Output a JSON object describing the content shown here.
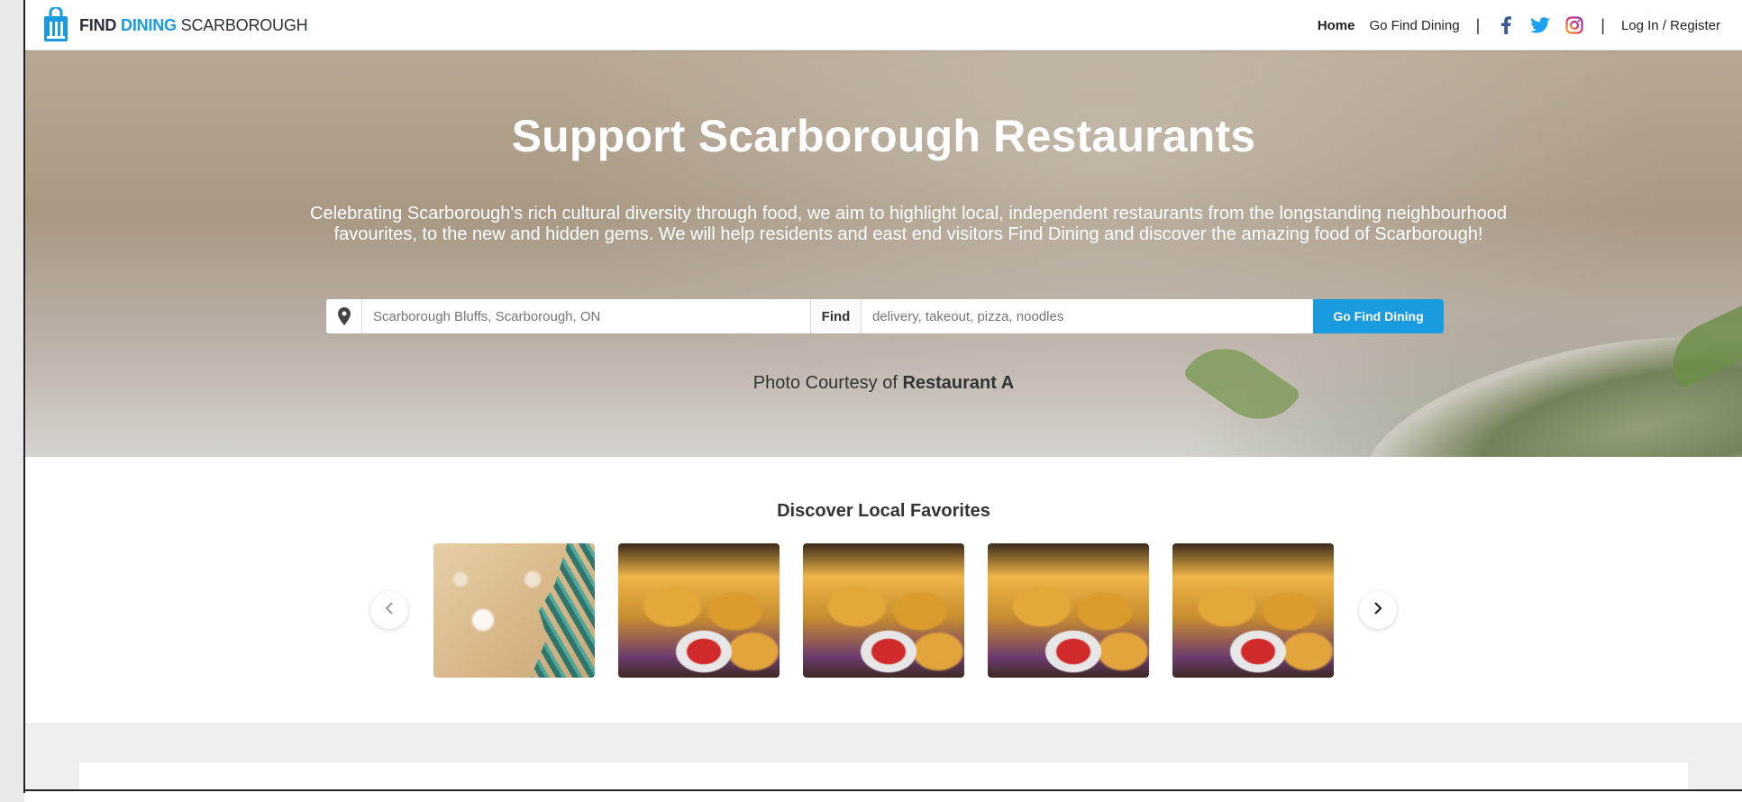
{
  "header": {
    "logo": {
      "part1": "FIND",
      "part2": "DINING",
      "part3": "SCARBOROUGH"
    },
    "nav": {
      "home": "Home",
      "go_find": "Go Find Dining",
      "separator": "|",
      "login": "Log In / Register"
    },
    "social_icons": [
      "facebook-icon",
      "twitter-icon",
      "instagram-icon"
    ]
  },
  "hero": {
    "title": "Support Scarborough Restaurants",
    "description": "Celebrating Scarborough's rich cultural diversity through food, we aim to highlight local, independent restaurants from the longstanding neighbourhood favourites, to the new and hidden gems. We will help residents and east end visitors Find Dining and discover the amazing food of Scarborough!",
    "search": {
      "location_placeholder": "Scarborough Bluffs, Scarborough, ON",
      "find_label": "Find",
      "query_placeholder": "delivery, takeout, pizza, noodles",
      "button_label": "Go Find Dining"
    },
    "credit_prefix": "Photo Courtesy of",
    "credit_name": "Restaurant A"
  },
  "discover": {
    "title": "Discover Local Favorites",
    "cards": [
      "holiday",
      "food",
      "food",
      "food",
      "food"
    ]
  },
  "colors": {
    "accent": "#1a9be0",
    "text": "#333333",
    "twitter": "#1da1f2",
    "facebook": "#3b5998"
  }
}
